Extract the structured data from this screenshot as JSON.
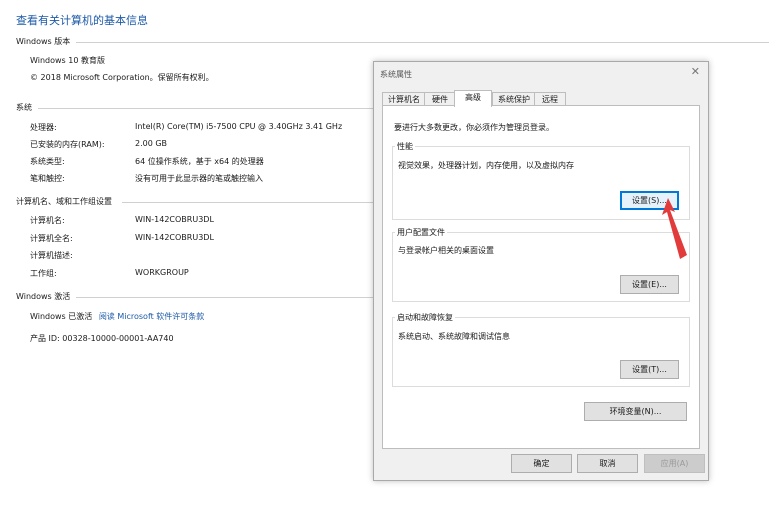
{
  "page": {
    "title": "查看有关计算机的基本信息"
  },
  "windows_edition": {
    "header": "Windows 版本",
    "edition": "Windows 10 教育版",
    "copyright": "© 2018 Microsoft Corporation。保留所有权利。"
  },
  "system": {
    "header": "系统",
    "rows": [
      {
        "label": "处理器:",
        "value": "Intel(R) Core(TM) i5-7500 CPU @ 3.40GHz   3.41 GHz"
      },
      {
        "label": "已安装的内存(RAM):",
        "value": "2.00 GB"
      },
      {
        "label": "系统类型:",
        "value": "64 位操作系统，基于 x64 的处理器"
      },
      {
        "label": "笔和触控:",
        "value": "没有可用于此显示器的笔或触控输入"
      }
    ]
  },
  "computer": {
    "header": "计算机名、域和工作组设置",
    "rows": [
      {
        "label": "计算机名:",
        "value": "WIN-142COBRU3DL"
      },
      {
        "label": "计算机全名:",
        "value": "WIN-142COBRU3DL"
      },
      {
        "label": "计算机描述:",
        "value": ""
      },
      {
        "label": "工作组:",
        "value": "WORKGROUP"
      }
    ]
  },
  "activation": {
    "header": "Windows 激活",
    "status": "Windows 已激活",
    "link": "阅读 Microsoft 软件许可条款",
    "product_id": "产品 ID: 00328-10000-00001-AA740"
  },
  "dialog": {
    "title": "系统属性",
    "close": "✕",
    "tabs": [
      "计算机名",
      "硬件",
      "高级",
      "系统保护",
      "远程"
    ],
    "active_tab": "高级",
    "admin_note": "要进行大多数更改，你必须作为管理员登录。",
    "performance": {
      "title": "性能",
      "desc": "视觉效果，处理器计划，内存使用，以及虚拟内存",
      "button": "设置(S)..."
    },
    "user_profiles": {
      "title": "用户配置文件",
      "desc": "与登录帐户相关的桌面设置",
      "button": "设置(E)..."
    },
    "startup": {
      "title": "启动和故障恢复",
      "desc": "系统启动、系统故障和调试信息",
      "button": "设置(T)..."
    },
    "env_button": "环境变量(N)...",
    "ok": "确定",
    "cancel": "取消",
    "apply": "应用(A)"
  },
  "colors": {
    "title_blue": "#1c5aa8",
    "arrow_red": "#e23b3b",
    "focus_blue": "#0078d7"
  }
}
